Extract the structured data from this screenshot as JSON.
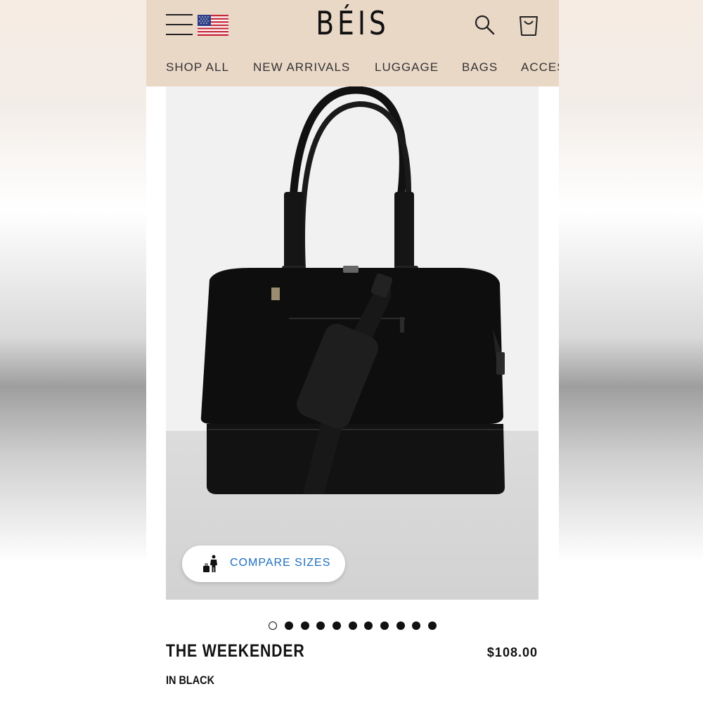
{
  "header": {
    "logo": "BÉIS",
    "background": "#ead8c7",
    "icons": [
      "hamburger-menu-icon",
      "us-flag-icon",
      "search-icon",
      "shopping-bag-icon"
    ]
  },
  "nav": {
    "items": [
      "SHOP ALL",
      "NEW ARRIVALS",
      "LUGGAGE",
      "BAGS",
      "ACCES"
    ]
  },
  "product": {
    "image_description_icon": "black-weekender-bag",
    "compare_button": {
      "label": "COMPARE SIZES",
      "icon": "person-luggage-icon",
      "color": "#1f6fbf"
    },
    "carousel": {
      "total": 11,
      "active_index": 0
    },
    "name": "THE WEEKENDER",
    "price": "$108.00",
    "variant": "IN BLACK"
  }
}
